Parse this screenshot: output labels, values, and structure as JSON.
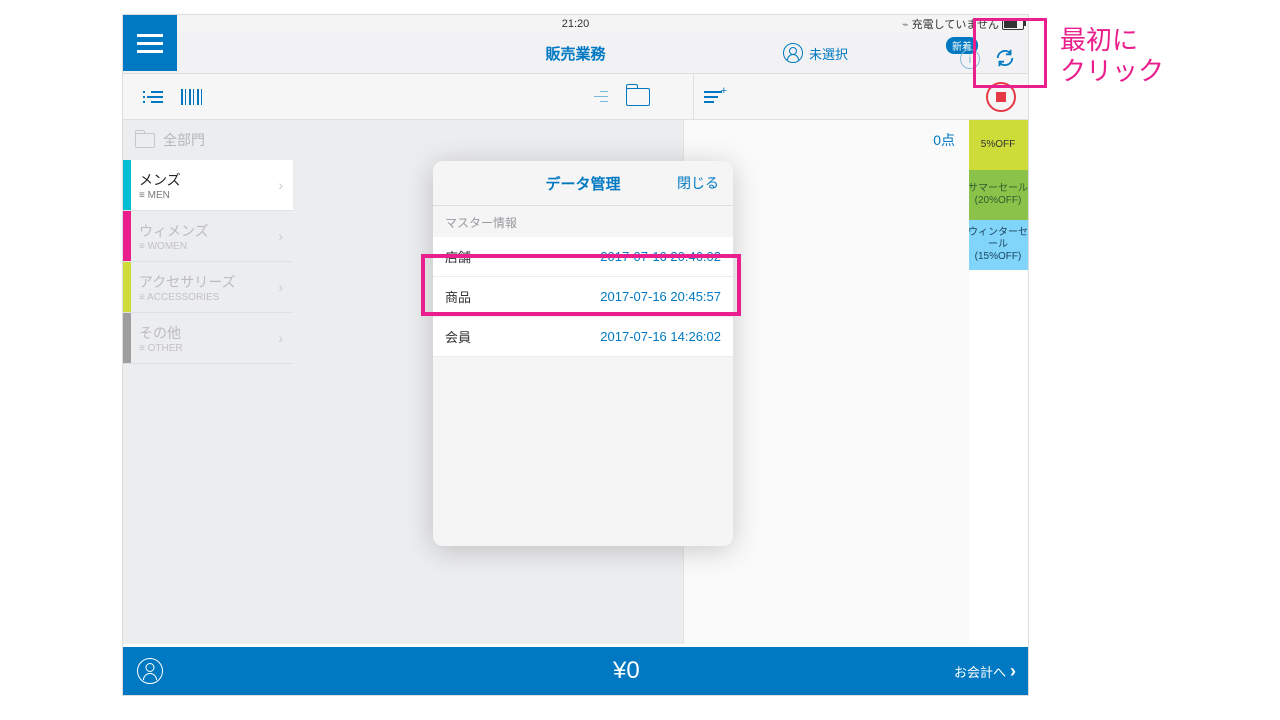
{
  "statusbar": {
    "device": "iPad",
    "time": "21:20",
    "charging": "充電していません"
  },
  "nav": {
    "title": "販売業務",
    "userStatus": "未選択",
    "badge": "新着"
  },
  "sidebar": {
    "allDepts": "全部門",
    "categories": [
      {
        "name": "メンズ",
        "sub": "≡ MEN",
        "color": "#00bcd4",
        "active": true
      },
      {
        "name": "ウィメンズ",
        "sub": "≡ WOMEN",
        "color": "#e91e8c",
        "active": false
      },
      {
        "name": "アクセサリーズ",
        "sub": "≡ ACCESSORIES",
        "color": "#cddc39",
        "active": false
      },
      {
        "name": "その他",
        "sub": "≡ OTHER",
        "color": "#9e9e9e",
        "active": false
      }
    ]
  },
  "discounts": [
    {
      "label": "5%OFF",
      "class": "d1"
    },
    {
      "label": "サマーセール\n(20%OFF)",
      "class": "d2"
    },
    {
      "label": "ウィンターセール\n(15%OFF)",
      "class": "d3"
    }
  ],
  "cart": {
    "count": "0点"
  },
  "footer": {
    "total": "¥0",
    "checkout": "お会計へ"
  },
  "popover": {
    "title": "データ管理",
    "close": "閉じる",
    "section": "マスター情報",
    "rows": [
      {
        "label": "店舗",
        "timestamp": "2017-07-16 20:46:02"
      },
      {
        "label": "商品",
        "timestamp": "2017-07-16 20:45:57"
      },
      {
        "label": "会員",
        "timestamp": "2017-07-16 14:26:02"
      }
    ]
  },
  "annotations": {
    "clickFirst": "最初に\nクリック"
  }
}
